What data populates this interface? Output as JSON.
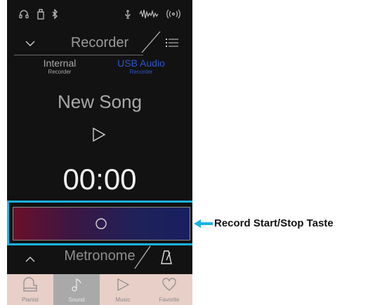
{
  "status_icons": [
    "headphones-icon",
    "usb-icon",
    "bluetooth-icon",
    "microphone-icon",
    "audio-level-icon",
    "wireless-icon"
  ],
  "recorder": {
    "title": "Recorder"
  },
  "tabs": [
    {
      "label": "Internal",
      "sublabel": "Recorder"
    },
    {
      "label": "USB Audio",
      "sublabel": "Recorder"
    }
  ],
  "song": {
    "title": "New Song",
    "time": "00:00"
  },
  "metronome": {
    "title": "Metronome"
  },
  "tabbar": [
    {
      "label": "Pianist",
      "icon": "piano-icon"
    },
    {
      "label": "Sound",
      "icon": "music-note-icon"
    },
    {
      "label": "Music",
      "icon": "play-icon"
    },
    {
      "label": "Favorite",
      "icon": "heart-icon"
    }
  ],
  "annotation": {
    "text": "Record Start/Stop Taste"
  },
  "colors": {
    "accent_blue": "#1ab3e8",
    "usb_tab": "#2e57c8",
    "tabbar_bg": "#e8cfc8",
    "tabbar_active": "#a9a9a9"
  }
}
